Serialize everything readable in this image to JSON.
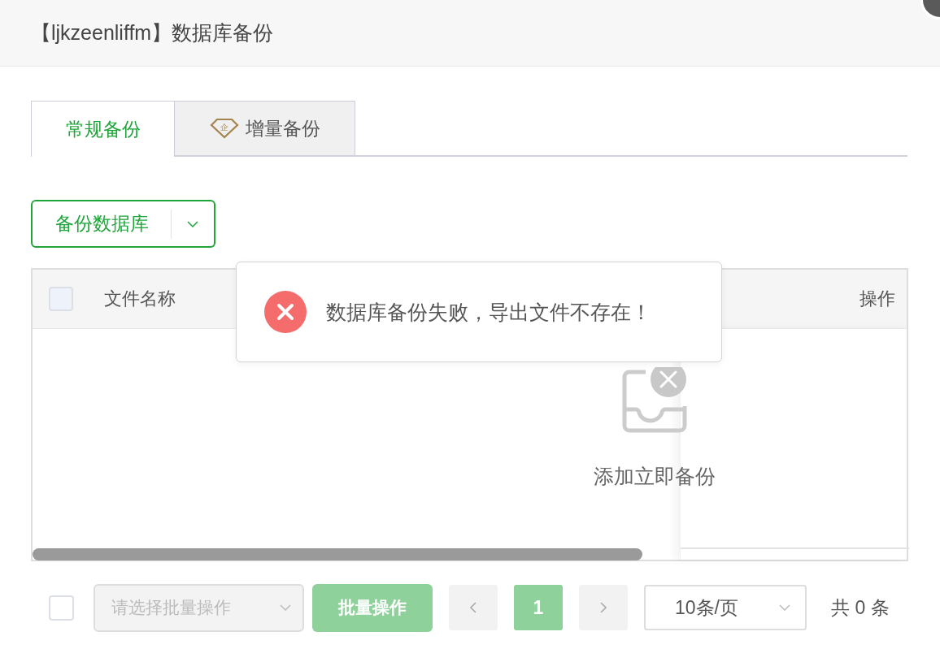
{
  "window": {
    "title": "【ljkzeenliffm】数据库备份"
  },
  "tabs": [
    {
      "label": "常规备份",
      "selected": true
    },
    {
      "label": "增量备份",
      "selected": false,
      "badge": "企"
    }
  ],
  "backup_button": {
    "label": "备份数据库"
  },
  "table": {
    "select_all": {
      "checked": false
    },
    "columns": [
      "文件名称",
      "操作"
    ],
    "empty_text": "添加立即备份"
  },
  "toast": {
    "kind": "error",
    "message": "数据库备份失败，导出文件不存在！"
  },
  "footer": {
    "select_all": {
      "checked": false
    },
    "batch_select": {
      "placeholder": "请选择批量操作",
      "disabled": true
    },
    "batch_button": {
      "label": "批量操作",
      "disabled": true
    },
    "pages": [
      {
        "label": "1",
        "selected": true
      }
    ],
    "page_size": "10条/页",
    "total": "共 0 条"
  }
}
